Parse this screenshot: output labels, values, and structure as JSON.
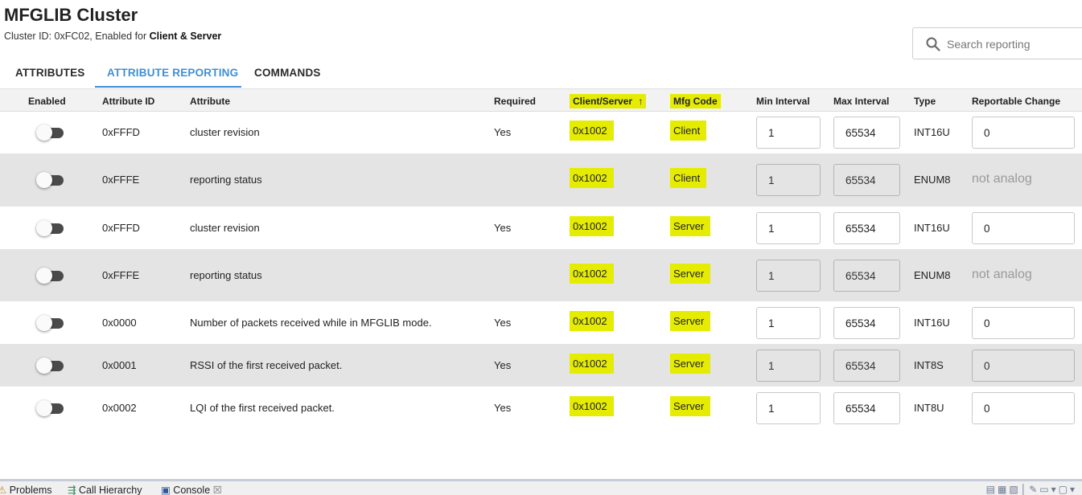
{
  "header": {
    "title": "MFGLIB Cluster",
    "subtitle_prefix": "Cluster ID: 0xFC02, Enabled for ",
    "subtitle_bold": "Client & Server"
  },
  "search": {
    "placeholder": "Search reporting",
    "icon": "search-icon"
  },
  "tabs": [
    {
      "label": "ATTRIBUTES",
      "active": false
    },
    {
      "label": "ATTRIBUTE REPORTING",
      "active": true
    },
    {
      "label": "COMMANDS",
      "active": false
    }
  ],
  "accent_color": "#3d8fd6",
  "highlight_color": "#e5ec00",
  "columns": {
    "enabled": "Enabled",
    "attribute_id": "Attribute ID",
    "attribute": "Attribute",
    "required": "Required",
    "client_server": "Client/Server",
    "sort_arrow": "↑",
    "mfg_code": "Mfg Code",
    "min_interval": "Min Interval",
    "max_interval": "Max Interval",
    "type": "Type",
    "reportable_change": "Reportable Change"
  },
  "rows": [
    {
      "enabled": false,
      "attribute_id": "0xFFFD",
      "attribute": "cluster revision",
      "required": "Yes",
      "mfg_code": "0x1002",
      "side": "Client",
      "min_interval": "1",
      "max_interval": "65534",
      "type": "INT16U",
      "reportable_change": "0",
      "editable": true
    },
    {
      "enabled": false,
      "attribute_id": "0xFFFE",
      "attribute": "reporting status",
      "required": "",
      "mfg_code": "0x1002",
      "side": "Client",
      "min_interval": "1",
      "max_interval": "65534",
      "type": "ENUM8",
      "reportable_change": "not analog",
      "editable": false
    },
    {
      "enabled": false,
      "attribute_id": "0xFFFD",
      "attribute": "cluster revision",
      "required": "Yes",
      "mfg_code": "0x1002",
      "side": "Server",
      "min_interval": "1",
      "max_interval": "65534",
      "type": "INT16U",
      "reportable_change": "0",
      "editable": true
    },
    {
      "enabled": false,
      "attribute_id": "0xFFFE",
      "attribute": "reporting status",
      "required": "",
      "mfg_code": "0x1002",
      "side": "Server",
      "min_interval": "1",
      "max_interval": "65534",
      "type": "ENUM8",
      "reportable_change": "not analog",
      "editable": false
    },
    {
      "enabled": false,
      "attribute_id": "0x0000",
      "attribute": "Number of packets received while in MFGLIB mode.",
      "required": "Yes",
      "mfg_code": "0x1002",
      "side": "Server",
      "min_interval": "1",
      "max_interval": "65534",
      "type": "INT16U",
      "reportable_change": "0",
      "editable": true
    },
    {
      "enabled": false,
      "attribute_id": "0x0001",
      "attribute": "RSSI of the first received packet.",
      "required": "Yes",
      "mfg_code": "0x1002",
      "side": "Server",
      "min_interval": "1",
      "max_interval": "65534",
      "type": "INT8S",
      "reportable_change": "0",
      "editable": false
    },
    {
      "enabled": false,
      "attribute_id": "0x0002",
      "attribute": "LQI of the first received packet.",
      "required": "Yes",
      "mfg_code": "0x1002",
      "side": "Server",
      "min_interval": "1",
      "max_interval": "65534",
      "type": "INT8U",
      "reportable_change": "0",
      "editable": true
    }
  ],
  "bottom_tabs": [
    {
      "label": "Problems",
      "icon": "problems-icon"
    },
    {
      "label": "Call Hierarchy",
      "icon": "call-hierarchy-icon"
    },
    {
      "label": "Console",
      "icon": "console-icon",
      "close": "☒"
    }
  ]
}
